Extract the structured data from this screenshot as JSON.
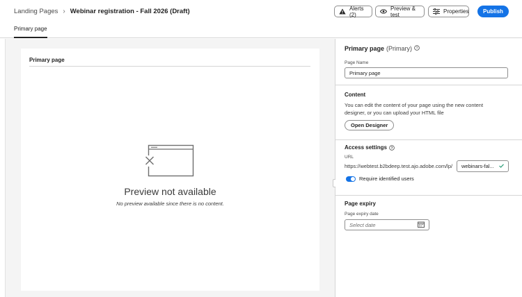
{
  "header": {
    "breadcrumb_parent": "Landing Pages",
    "breadcrumb_separator": "›",
    "title": "Webinar registration - Fall 2026 (Draft)",
    "alerts_label": "Alerts (2)",
    "preview_label": "Preview & test",
    "properties_label": "Properties",
    "publish_label": "Publish",
    "tab_label": "Primary page"
  },
  "canvas": {
    "card_title": "Primary page",
    "preview_title": "Preview not available",
    "preview_subtitle": "No preview available since there is no content."
  },
  "panel": {
    "title": "Primary page",
    "title_suffix": "(Primary)",
    "page_name_label": "Page Name",
    "page_name_value": "Primary page",
    "content_heading": "Content",
    "content_desc": "You can edit the content of your page using the new content designer, or you can upload your HTML file",
    "open_designer_label": "Open Designer",
    "access_heading": "Access settings",
    "url_label": "URL",
    "url_prefix": "https://webtest.b2bdeep.test.ajo.adobe.com/lp/",
    "url_slug": "webinars-fal...",
    "require_users_label": "Require identified users",
    "require_users_on": true,
    "expiry_heading": "Page expiry",
    "expiry_label": "Page expiry date",
    "expiry_placeholder": "Select date"
  },
  "colors": {
    "accent": "#1473e6",
    "valid": "#2d9d78"
  }
}
